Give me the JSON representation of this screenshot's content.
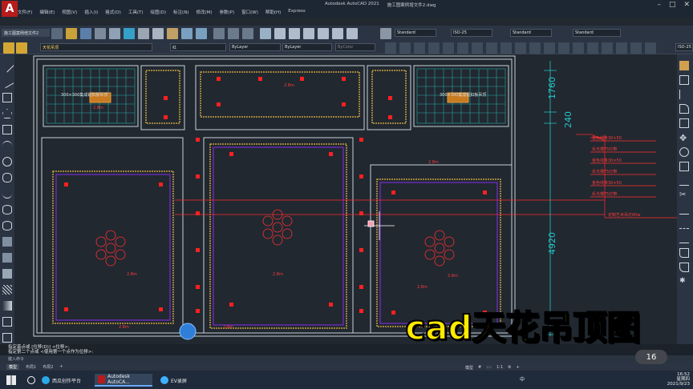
{
  "app": {
    "title": "Autodesk AutoCAD 2021",
    "file": "施工图案例增文件2.dwg",
    "logo": "A"
  },
  "menus": [
    "文件(F)",
    "编辑(E)",
    "视图(V)",
    "插入(I)",
    "格式(O)",
    "工具(T)",
    "绘图(D)",
    "标注(N)",
    "修改(M)",
    "参数(P)",
    "窗口(W)",
    "帮助(H)",
    "Express"
  ],
  "doc_tab": "施工图案例增文件2",
  "toolbar": {
    "style1": "Standard",
    "style2": "ISO-25",
    "style3": "Standard",
    "style4": "Standard",
    "layer": "天花吊顶",
    "color": "红",
    "linetype1": "ByLayer",
    "linetype2": "ByLayer",
    "plotstyle": "ByColor",
    "scale": "ISO-25"
  },
  "drawing": {
    "dims": [
      "1760",
      "240",
      "4920"
    ],
    "grid_labels": [
      "300×300集成铝扣板吊顶",
      "300×300集成铝扣板吊顶"
    ],
    "annotations": [
      "金色线条30×50",
      "反光槽T5灯带",
      "金色线条30×50",
      "反光槽T5灯带",
      "金色线条30×50",
      "反光槽T5灯带",
      "定制艺术吊灯60w"
    ],
    "small_levels": [
      "2.8m",
      "2.8m",
      "2.8m",
      "2.8m",
      "2.8m",
      "2.8m",
      "2.8m",
      "2.8m",
      "2.8m"
    ],
    "colors": {
      "bg": "#212830",
      "line": "#c7cfd8",
      "red": "#ff2a2a",
      "gold": "#c8a040",
      "cyan": "#25c5c5",
      "purple": "#8a2be2"
    }
  },
  "command": {
    "line1": "指定基点或 [位移(D)] <位移>:",
    "line2": "指定第二个点或 <使用第一个点作为位移>:",
    "input": "键入命令"
  },
  "layout_tabs": [
    "模型",
    "布局1",
    "布局2"
  ],
  "status_items": [
    "模型",
    "#",
    "::::",
    "1:1",
    "⚙",
    "+"
  ],
  "taskbar": {
    "apps": [
      "西瓜创作平台",
      "Autodesk AutoCA...",
      "EV录屏"
    ],
    "ime": "中",
    "time": "16:52",
    "day": "星期四",
    "date": "2021/9/23"
  },
  "overlay_text": "cad天花吊顶图",
  "badge_text": "16"
}
